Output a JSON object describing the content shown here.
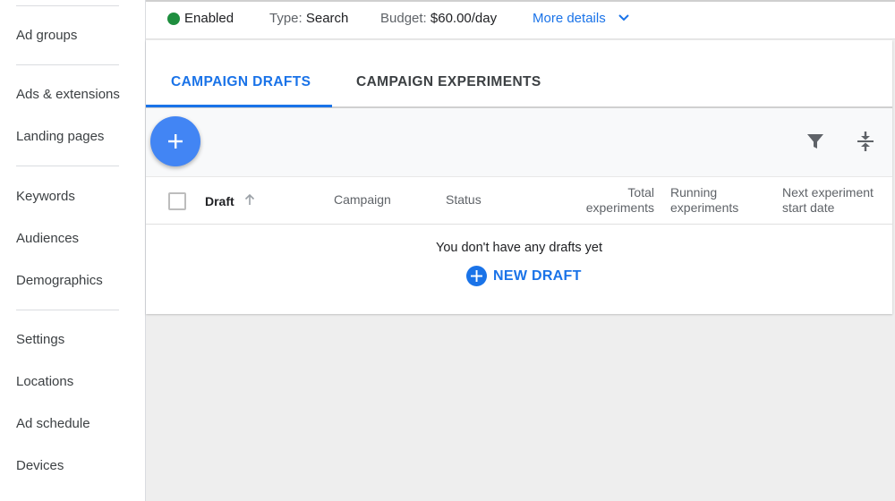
{
  "sidebar": {
    "items": [
      {
        "label": "Ad groups"
      },
      {
        "label": "Ads & extensions"
      },
      {
        "label": "Landing pages"
      },
      {
        "label": "Keywords"
      },
      {
        "label": "Audiences"
      },
      {
        "label": "Demographics"
      },
      {
        "label": "Settings"
      },
      {
        "label": "Locations"
      },
      {
        "label": "Ad schedule"
      },
      {
        "label": "Devices"
      }
    ]
  },
  "summary": {
    "status": "Enabled",
    "status_color": "#1e8e3e",
    "type_label": "Type:",
    "type_value": "Search",
    "budget_label": "Budget:",
    "budget_value": "$60.00/day",
    "more_details": "More details"
  },
  "tabs": [
    {
      "label": "CAMPAIGN DRAFTS",
      "active": true
    },
    {
      "label": "CAMPAIGN EXPERIMENTS",
      "active": false
    }
  ],
  "toolbar": {
    "add_icon": "plus-icon",
    "filter_icon": "filter-icon",
    "collapse_icon": "compact-rows-icon"
  },
  "table": {
    "columns": [
      {
        "label": "Draft",
        "sorted": "ascending"
      },
      {
        "label": "Campaign"
      },
      {
        "label": "Status"
      },
      {
        "line1": "Total",
        "line2": "experiments"
      },
      {
        "line1": "Running",
        "line2": "experiments"
      },
      {
        "line1": "Next experiment",
        "line2": "start date"
      }
    ],
    "empty_message": "You don't have any drafts yet",
    "new_draft_label": "NEW DRAFT"
  },
  "colors": {
    "accent": "#1a73e8",
    "fab": "#4285f4",
    "enabled": "#1e8e3e"
  }
}
